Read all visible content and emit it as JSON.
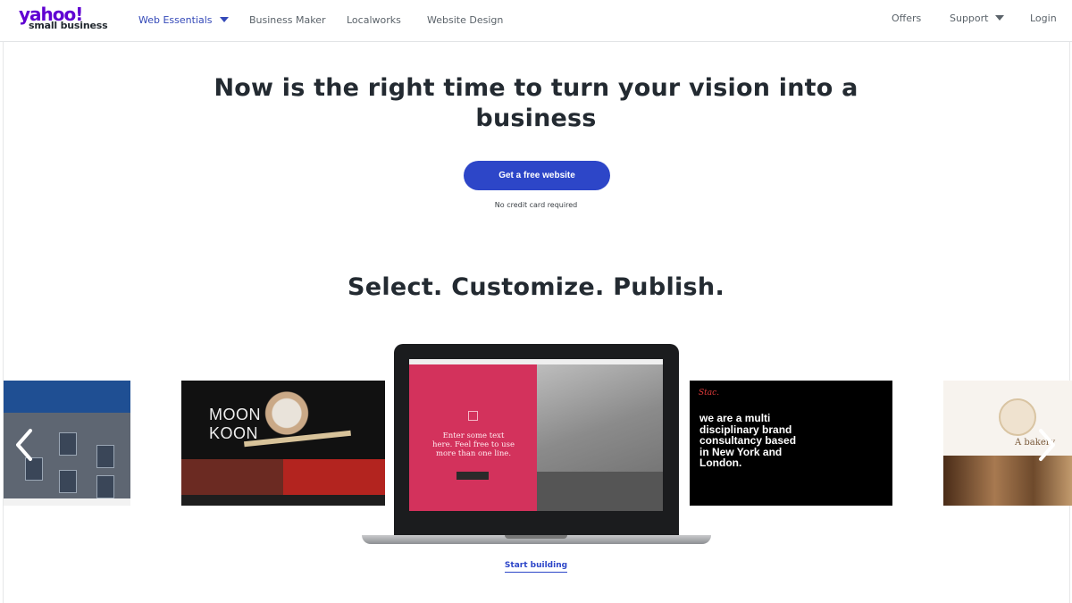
{
  "brand": {
    "wordmark": "yahoo!",
    "subline": "small business",
    "accent": "#6001d2"
  },
  "nav": {
    "items": [
      {
        "label": "Web Essentials",
        "active": true,
        "has_dropdown": true
      },
      {
        "label": "Business Maker"
      },
      {
        "label": "Localworks"
      },
      {
        "label": "Website Design"
      }
    ],
    "right": [
      {
        "label": "Offers"
      },
      {
        "label": "Support",
        "has_dropdown": true
      },
      {
        "label": "Login"
      }
    ]
  },
  "hero": {
    "title_line1": "Now is the right time to turn your vision into a",
    "title_line2": "business",
    "cta_label": "Get a free website",
    "cta_color": "#2d46c8",
    "cta_note": "No credit card required"
  },
  "section": {
    "title": "Select. Customize. Publish."
  },
  "carousel": {
    "prev_icon": "chevron-left-icon",
    "next_icon": "chevron-right-icon",
    "moon_title_line1": "MOON",
    "moon_title_line2": "KOON",
    "black_tagline": "we are a multi disciplinary brand consultancy based in New York and London.",
    "black_logo": "Stac.",
    "laptop_placeholder": "Enter some text here. Feel free to use more than one line.",
    "bakery_text": "A bakery"
  },
  "footer_link": {
    "label": "Start building"
  }
}
